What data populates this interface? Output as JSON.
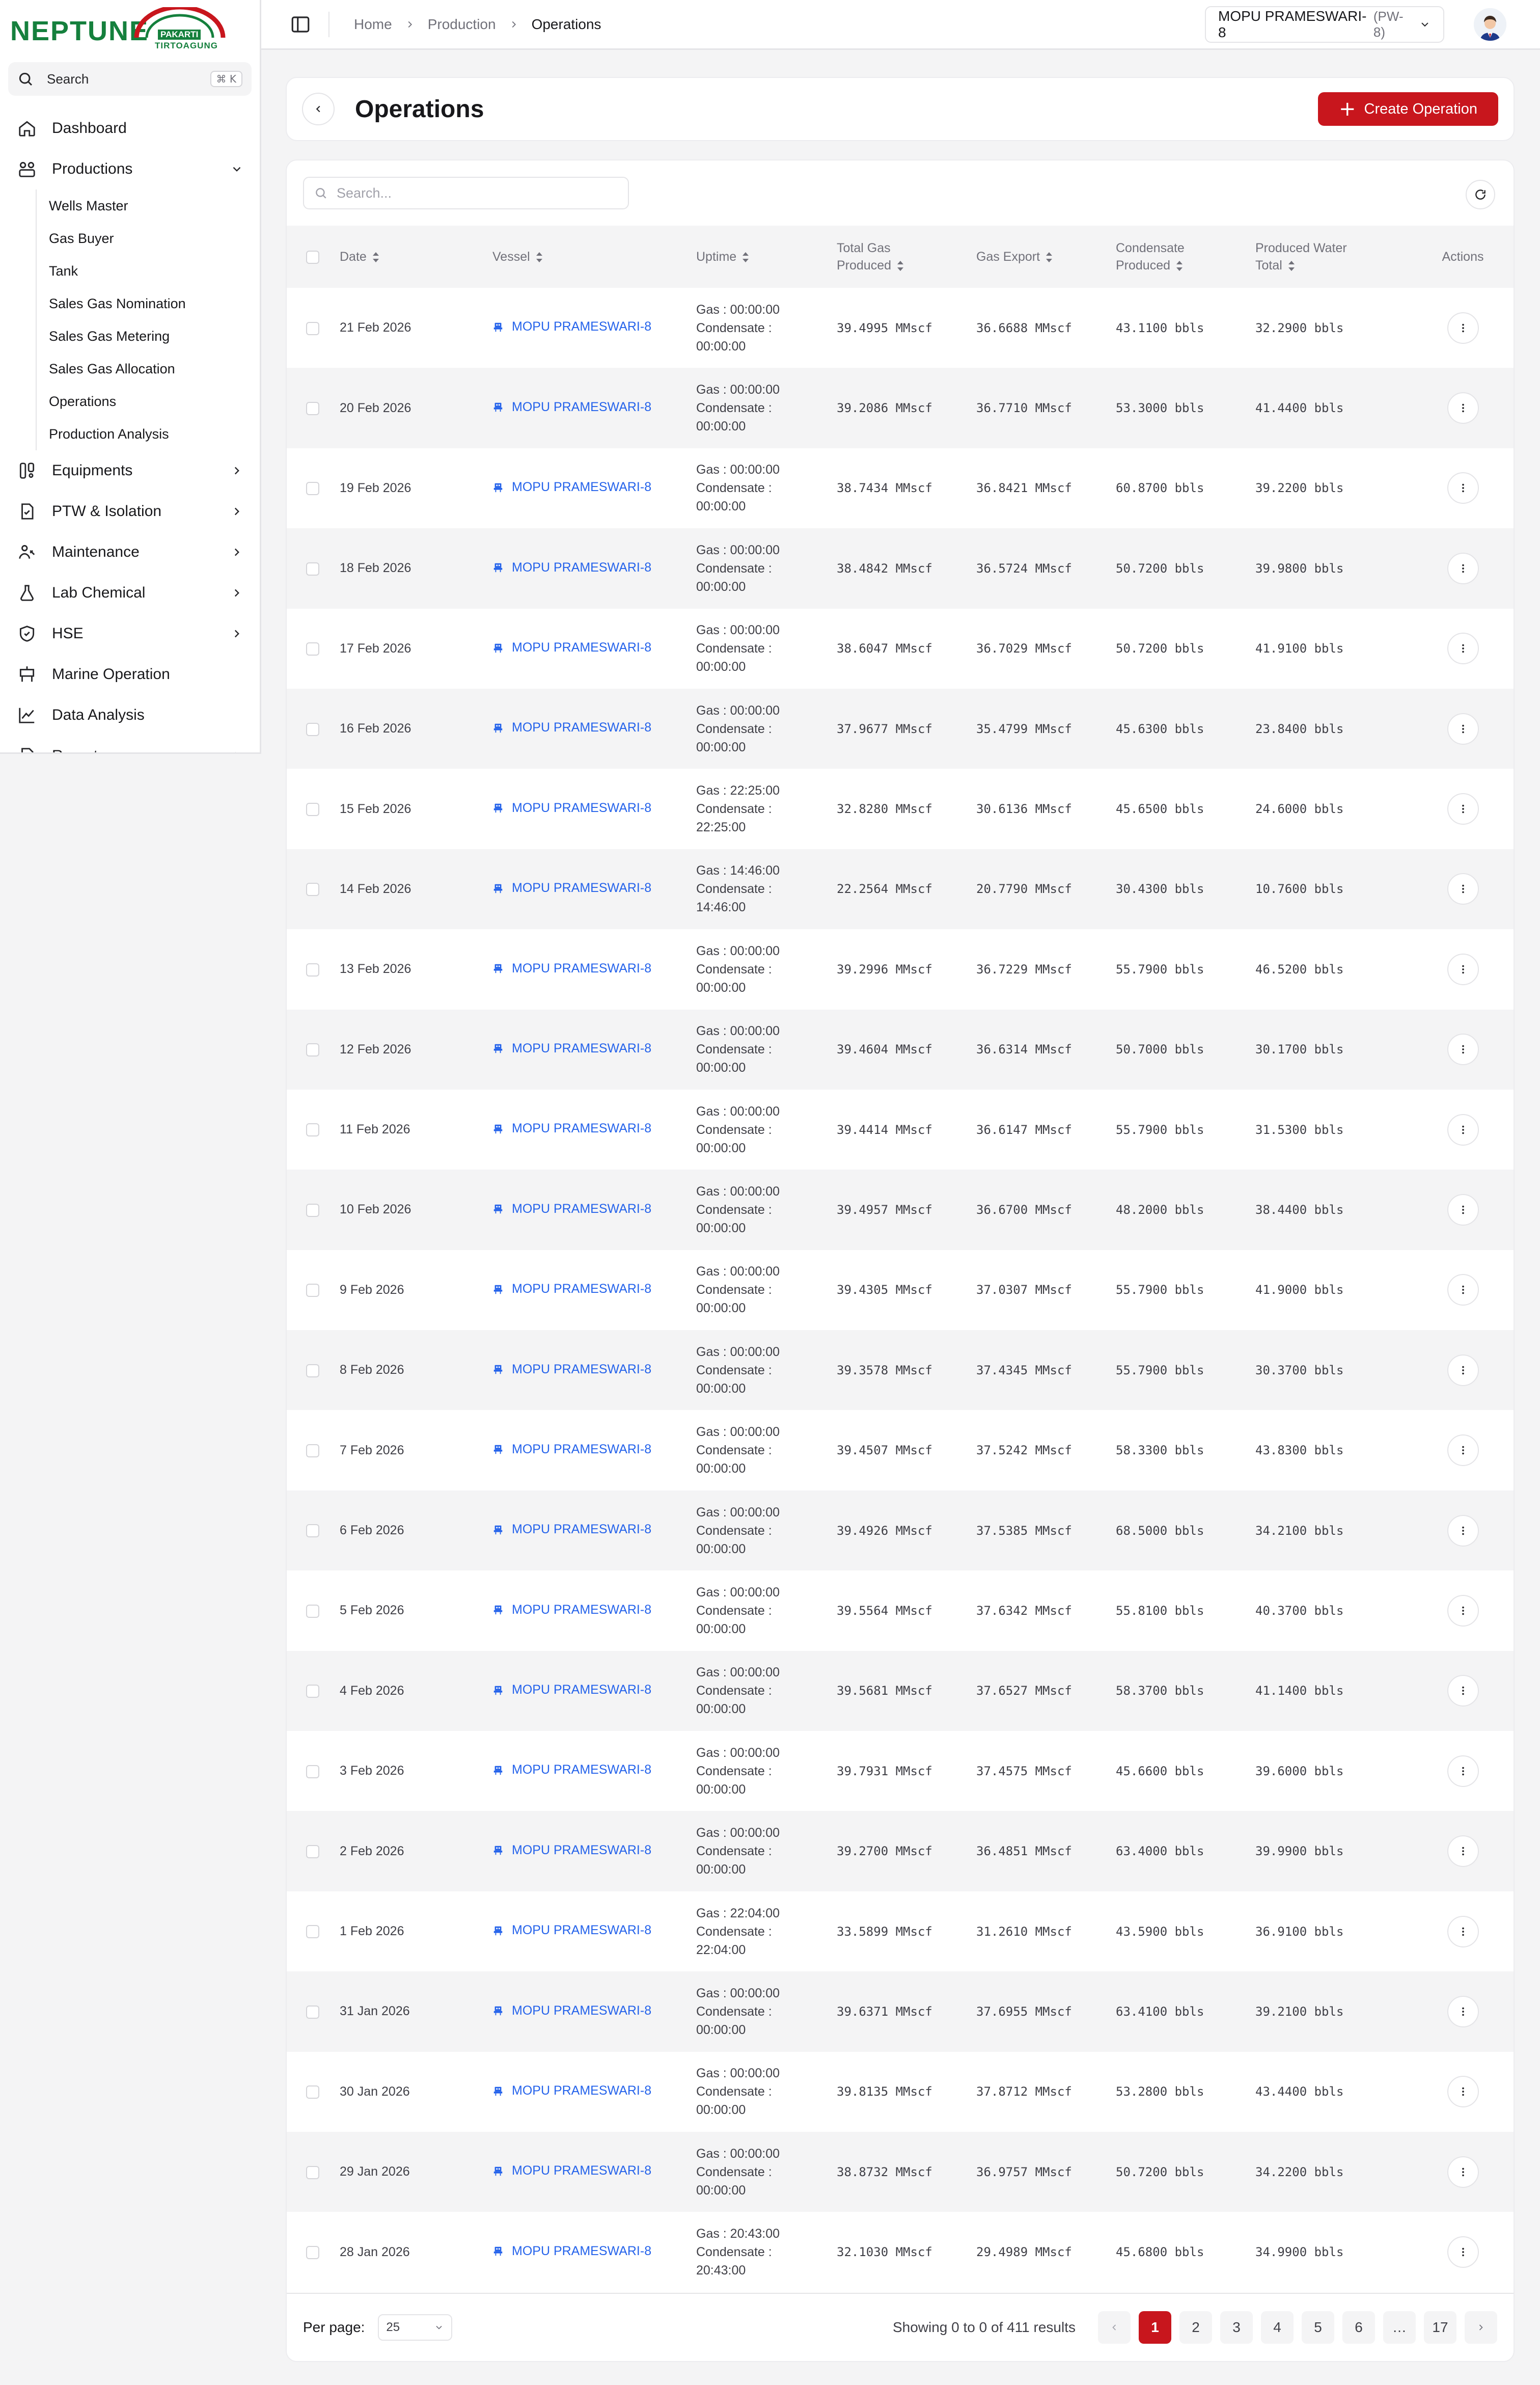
{
  "brand": {
    "name": "NEPTUNE",
    "line1": "PAKARTI",
    "line2": "TIRTOAGUNG"
  },
  "sidebar": {
    "search_label": "Search",
    "search_shortcut": "⌘ K",
    "items": [
      {
        "label": "Dashboard",
        "icon": "home-icon"
      },
      {
        "label": "Productions",
        "icon": "production-icon",
        "expanded": true
      },
      {
        "label": "Equipments",
        "icon": "equipment-icon"
      },
      {
        "label": "PTW & Isolation",
        "icon": "permit-icon"
      },
      {
        "label": "Maintenance",
        "icon": "maintenance-icon"
      },
      {
        "label": "Lab Chemical",
        "icon": "flask-icon"
      },
      {
        "label": "HSE",
        "icon": "shield-icon"
      },
      {
        "label": "Marine Operation",
        "icon": "marine-icon"
      },
      {
        "label": "Data Analysis",
        "icon": "chart-icon"
      },
      {
        "label": "Report",
        "icon": "report-icon"
      }
    ],
    "productions_sub": [
      "Wells Master",
      "Gas Buyer",
      "Tank",
      "Sales Gas Nomination",
      "Sales Gas Metering",
      "Sales Gas Allocation",
      "Operations",
      "Production Analysis"
    ]
  },
  "topbar": {
    "breadcrumbs": [
      "Home",
      "Production",
      "Operations"
    ],
    "vessel_name": "MOPU PRAMESWARI-8",
    "vessel_code": "(PW-8)"
  },
  "page": {
    "title": "Operations",
    "create_label": "Create Operation",
    "search_placeholder": "Search..."
  },
  "table": {
    "headers": {
      "date": "Date",
      "vessel": "Vessel",
      "uptime": "Uptime",
      "total_gas_1": "Total Gas",
      "total_gas_2": "Produced",
      "gas_export": "Gas Export",
      "condensate_1": "Condensate",
      "condensate_2": "Produced",
      "water_1": "Produced Water",
      "water_2": "Total",
      "actions": "Actions"
    },
    "rows": [
      {
        "date": "21 Feb 2026",
        "vessel": "MOPU PRAMESWARI-8",
        "gas_up": "Gas : 00:00:00",
        "cond_label": "Condensate :",
        "cond_up": "00:00:00",
        "tgp": "39.4995 MMscf",
        "gexp": "36.6688 MMscf",
        "cond": "43.1100 bbls",
        "pw": "32.2900 bbls"
      },
      {
        "date": "20 Feb 2026",
        "vessel": "MOPU PRAMESWARI-8",
        "gas_up": "Gas : 00:00:00",
        "cond_label": "Condensate :",
        "cond_up": "00:00:00",
        "tgp": "39.2086 MMscf",
        "gexp": "36.7710 MMscf",
        "cond": "53.3000 bbls",
        "pw": "41.4400 bbls"
      },
      {
        "date": "19 Feb 2026",
        "vessel": "MOPU PRAMESWARI-8",
        "gas_up": "Gas : 00:00:00",
        "cond_label": "Condensate :",
        "cond_up": "00:00:00",
        "tgp": "38.7434 MMscf",
        "gexp": "36.8421 MMscf",
        "cond": "60.8700 bbls",
        "pw": "39.2200 bbls"
      },
      {
        "date": "18 Feb 2026",
        "vessel": "MOPU PRAMESWARI-8",
        "gas_up": "Gas : 00:00:00",
        "cond_label": "Condensate :",
        "cond_up": "00:00:00",
        "tgp": "38.4842 MMscf",
        "gexp": "36.5724 MMscf",
        "cond": "50.7200 bbls",
        "pw": "39.9800 bbls"
      },
      {
        "date": "17 Feb 2026",
        "vessel": "MOPU PRAMESWARI-8",
        "gas_up": "Gas : 00:00:00",
        "cond_label": "Condensate :",
        "cond_up": "00:00:00",
        "tgp": "38.6047 MMscf",
        "gexp": "36.7029 MMscf",
        "cond": "50.7200 bbls",
        "pw": "41.9100 bbls"
      },
      {
        "date": "16 Feb 2026",
        "vessel": "MOPU PRAMESWARI-8",
        "gas_up": "Gas : 00:00:00",
        "cond_label": "Condensate :",
        "cond_up": "00:00:00",
        "tgp": "37.9677 MMscf",
        "gexp": "35.4799 MMscf",
        "cond": "45.6300 bbls",
        "pw": "23.8400 bbls"
      },
      {
        "date": "15 Feb 2026",
        "vessel": "MOPU PRAMESWARI-8",
        "gas_up": "Gas : 22:25:00",
        "cond_label": "Condensate :",
        "cond_up": "22:25:00",
        "tgp": "32.8280 MMscf",
        "gexp": "30.6136 MMscf",
        "cond": "45.6500 bbls",
        "pw": "24.6000 bbls"
      },
      {
        "date": "14 Feb 2026",
        "vessel": "MOPU PRAMESWARI-8",
        "gas_up": "Gas : 14:46:00",
        "cond_label": "Condensate :",
        "cond_up": "14:46:00",
        "tgp": "22.2564 MMscf",
        "gexp": "20.7790 MMscf",
        "cond": "30.4300 bbls",
        "pw": "10.7600 bbls"
      },
      {
        "date": "13 Feb 2026",
        "vessel": "MOPU PRAMESWARI-8",
        "gas_up": "Gas : 00:00:00",
        "cond_label": "Condensate :",
        "cond_up": "00:00:00",
        "tgp": "39.2996 MMscf",
        "gexp": "36.7229 MMscf",
        "cond": "55.7900 bbls",
        "pw": "46.5200 bbls"
      },
      {
        "date": "12 Feb 2026",
        "vessel": "MOPU PRAMESWARI-8",
        "gas_up": "Gas : 00:00:00",
        "cond_label": "Condensate :",
        "cond_up": "00:00:00",
        "tgp": "39.4604 MMscf",
        "gexp": "36.6314 MMscf",
        "cond": "50.7000 bbls",
        "pw": "30.1700 bbls"
      },
      {
        "date": "11 Feb 2026",
        "vessel": "MOPU PRAMESWARI-8",
        "gas_up": "Gas : 00:00:00",
        "cond_label": "Condensate :",
        "cond_up": "00:00:00",
        "tgp": "39.4414 MMscf",
        "gexp": "36.6147 MMscf",
        "cond": "55.7900 bbls",
        "pw": "31.5300 bbls"
      },
      {
        "date": "10 Feb 2026",
        "vessel": "MOPU PRAMESWARI-8",
        "gas_up": "Gas : 00:00:00",
        "cond_label": "Condensate :",
        "cond_up": "00:00:00",
        "tgp": "39.4957 MMscf",
        "gexp": "36.6700 MMscf",
        "cond": "48.2000 bbls",
        "pw": "38.4400 bbls"
      },
      {
        "date": "9 Feb 2026",
        "vessel": "MOPU PRAMESWARI-8",
        "gas_up": "Gas : 00:00:00",
        "cond_label": "Condensate :",
        "cond_up": "00:00:00",
        "tgp": "39.4305 MMscf",
        "gexp": "37.0307 MMscf",
        "cond": "55.7900 bbls",
        "pw": "41.9000 bbls"
      },
      {
        "date": "8 Feb 2026",
        "vessel": "MOPU PRAMESWARI-8",
        "gas_up": "Gas : 00:00:00",
        "cond_label": "Condensate :",
        "cond_up": "00:00:00",
        "tgp": "39.3578 MMscf",
        "gexp": "37.4345 MMscf",
        "cond": "55.7900 bbls",
        "pw": "30.3700 bbls"
      },
      {
        "date": "7 Feb 2026",
        "vessel": "MOPU PRAMESWARI-8",
        "gas_up": "Gas : 00:00:00",
        "cond_label": "Condensate :",
        "cond_up": "00:00:00",
        "tgp": "39.4507 MMscf",
        "gexp": "37.5242 MMscf",
        "cond": "58.3300 bbls",
        "pw": "43.8300 bbls"
      },
      {
        "date": "6 Feb 2026",
        "vessel": "MOPU PRAMESWARI-8",
        "gas_up": "Gas : 00:00:00",
        "cond_label": "Condensate :",
        "cond_up": "00:00:00",
        "tgp": "39.4926 MMscf",
        "gexp": "37.5385 MMscf",
        "cond": "68.5000 bbls",
        "pw": "34.2100 bbls"
      },
      {
        "date": "5 Feb 2026",
        "vessel": "MOPU PRAMESWARI-8",
        "gas_up": "Gas : 00:00:00",
        "cond_label": "Condensate :",
        "cond_up": "00:00:00",
        "tgp": "39.5564 MMscf",
        "gexp": "37.6342 MMscf",
        "cond": "55.8100 bbls",
        "pw": "40.3700 bbls"
      },
      {
        "date": "4 Feb 2026",
        "vessel": "MOPU PRAMESWARI-8",
        "gas_up": "Gas : 00:00:00",
        "cond_label": "Condensate :",
        "cond_up": "00:00:00",
        "tgp": "39.5681 MMscf",
        "gexp": "37.6527 MMscf",
        "cond": "58.3700 bbls",
        "pw": "41.1400 bbls"
      },
      {
        "date": "3 Feb 2026",
        "vessel": "MOPU PRAMESWARI-8",
        "gas_up": "Gas : 00:00:00",
        "cond_label": "Condensate :",
        "cond_up": "00:00:00",
        "tgp": "39.7931 MMscf",
        "gexp": "37.4575 MMscf",
        "cond": "45.6600 bbls",
        "pw": "39.6000 bbls"
      },
      {
        "date": "2 Feb 2026",
        "vessel": "MOPU PRAMESWARI-8",
        "gas_up": "Gas : 00:00:00",
        "cond_label": "Condensate :",
        "cond_up": "00:00:00",
        "tgp": "39.2700 MMscf",
        "gexp": "36.4851 MMscf",
        "cond": "63.4000 bbls",
        "pw": "39.9900 bbls"
      },
      {
        "date": "1 Feb 2026",
        "vessel": "MOPU PRAMESWARI-8",
        "gas_up": "Gas : 22:04:00",
        "cond_label": "Condensate :",
        "cond_up": "22:04:00",
        "tgp": "33.5899 MMscf",
        "gexp": "31.2610 MMscf",
        "cond": "43.5900 bbls",
        "pw": "36.9100 bbls"
      },
      {
        "date": "31 Jan 2026",
        "vessel": "MOPU PRAMESWARI-8",
        "gas_up": "Gas : 00:00:00",
        "cond_label": "Condensate :",
        "cond_up": "00:00:00",
        "tgp": "39.6371 MMscf",
        "gexp": "37.6955 MMscf",
        "cond": "63.4100 bbls",
        "pw": "39.2100 bbls"
      },
      {
        "date": "30 Jan 2026",
        "vessel": "MOPU PRAMESWARI-8",
        "gas_up": "Gas : 00:00:00",
        "cond_label": "Condensate :",
        "cond_up": "00:00:00",
        "tgp": "39.8135 MMscf",
        "gexp": "37.8712 MMscf",
        "cond": "53.2800 bbls",
        "pw": "43.4400 bbls"
      },
      {
        "date": "29 Jan 2026",
        "vessel": "MOPU PRAMESWARI-8",
        "gas_up": "Gas : 00:00:00",
        "cond_label": "Condensate :",
        "cond_up": "00:00:00",
        "tgp": "38.8732 MMscf",
        "gexp": "36.9757 MMscf",
        "cond": "50.7200 bbls",
        "pw": "34.2200 bbls"
      },
      {
        "date": "28 Jan 2026",
        "vessel": "MOPU PRAMESWARI-8",
        "gas_up": "Gas : 20:43:00",
        "cond_label": "Condensate :",
        "cond_up": "20:43:00",
        "tgp": "32.1030 MMscf",
        "gexp": "29.4989 MMscf",
        "cond": "45.6800 bbls",
        "pw": "34.9900 bbls"
      }
    ]
  },
  "footer": {
    "per_page_label": "Per page:",
    "per_page_value": "25",
    "showing": "Showing 0 to 0 of 411 results",
    "pages": [
      "1",
      "2",
      "3",
      "4",
      "5",
      "6",
      "…",
      "17"
    ],
    "active_page": "1"
  },
  "colors": {
    "brand_green": "#15803d",
    "primary_red": "#c8161d",
    "link_blue": "#2563eb"
  }
}
